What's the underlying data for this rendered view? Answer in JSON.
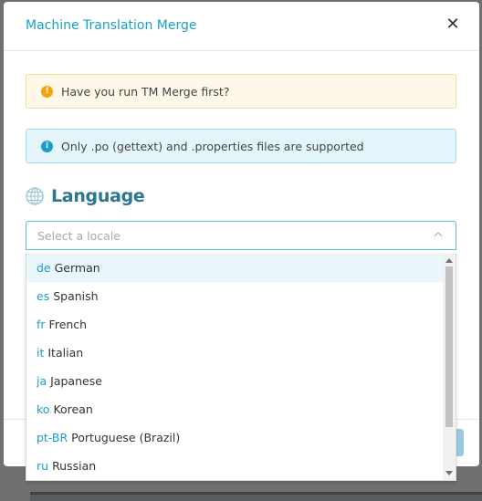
{
  "modal": {
    "title": "Machine Translation Merge",
    "close_glyph": "✕"
  },
  "alerts": {
    "warning": {
      "icon": "!",
      "text": "Have you run TM Merge first?"
    },
    "info": {
      "icon": "i",
      "text": "Only .po (gettext) and .properties files are supported"
    }
  },
  "language": {
    "title": "Language",
    "icon": "globe-icon"
  },
  "locale_select": {
    "placeholder": "Select a locale",
    "options": [
      {
        "code": "de",
        "name": "German"
      },
      {
        "code": "es",
        "name": "Spanish"
      },
      {
        "code": "fr",
        "name": "French"
      },
      {
        "code": "it",
        "name": "Italian"
      },
      {
        "code": "ja",
        "name": "Japanese"
      },
      {
        "code": "ko",
        "name": "Korean"
      },
      {
        "code": "pt-BR",
        "name": "Portuguese (Brazil)"
      },
      {
        "code": "ru",
        "name": "Russian"
      }
    ]
  },
  "colors": {
    "accent": "#1a9ec9",
    "heading": "#2b7590",
    "warning": "#f0a30a"
  }
}
